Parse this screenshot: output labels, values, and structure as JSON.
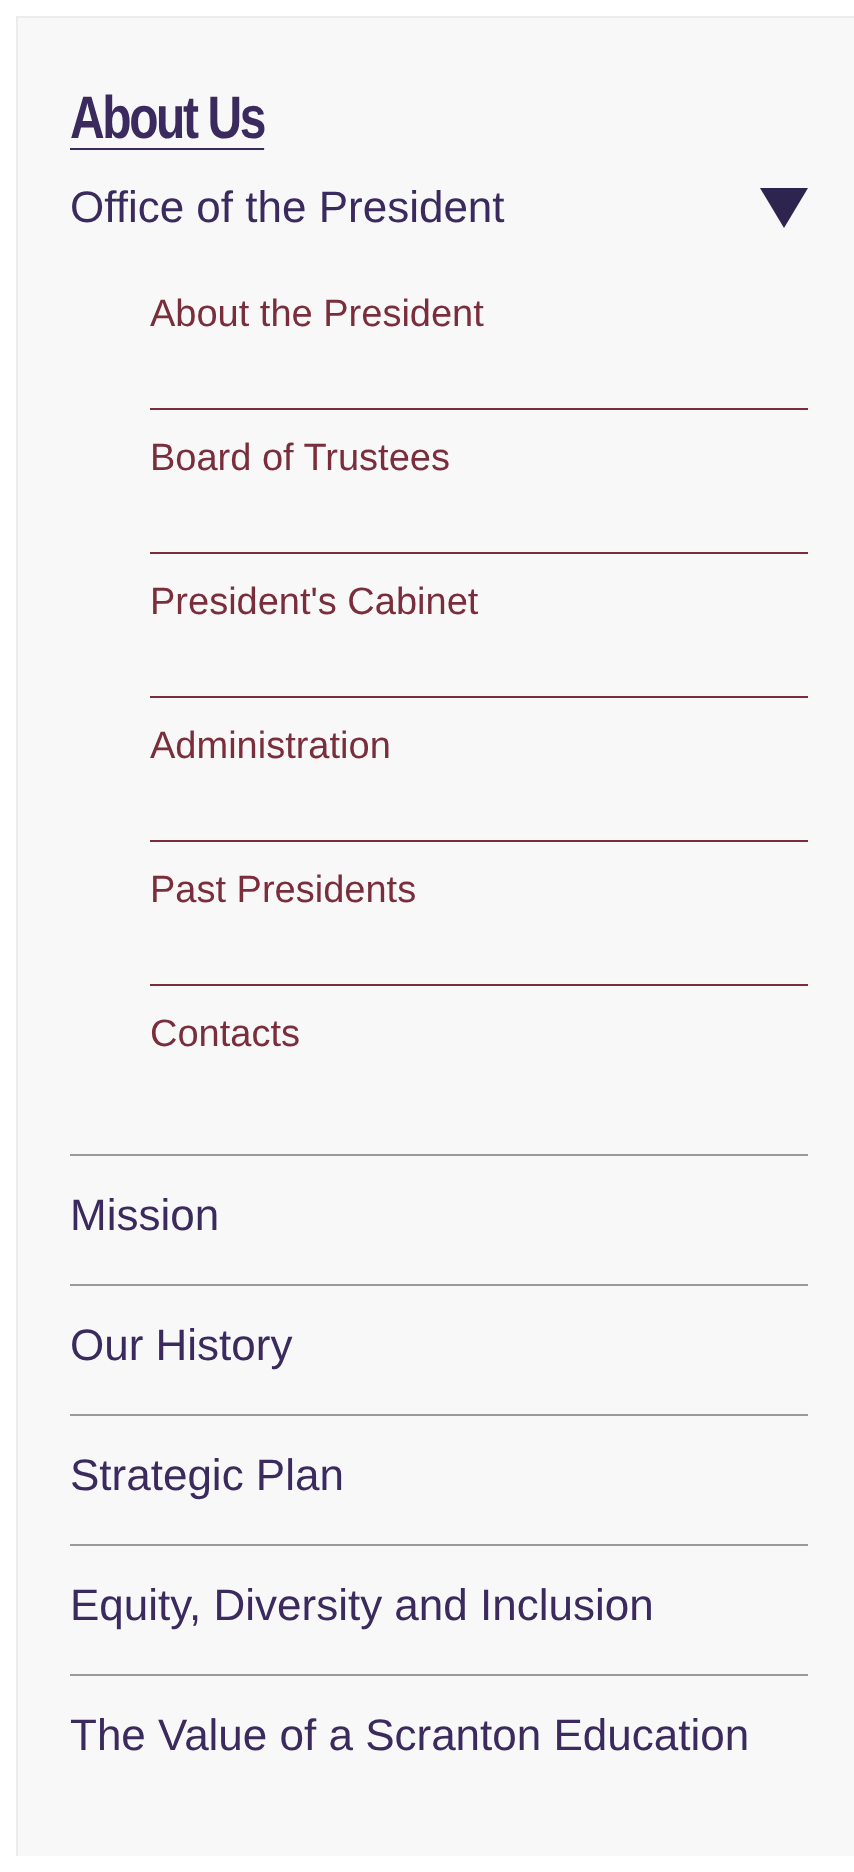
{
  "title": "About Us",
  "section": {
    "label": "Office of the President",
    "expanded": true,
    "children": [
      {
        "label": "About the President"
      },
      {
        "label": "Board of Trustees"
      },
      {
        "label": "President's Cabinet"
      },
      {
        "label": "Administration"
      },
      {
        "label": "Past Presidents"
      },
      {
        "label": "Contacts"
      }
    ]
  },
  "items": [
    {
      "label": "Mission"
    },
    {
      "label": "Our History"
    },
    {
      "label": "Strategic Plan"
    },
    {
      "label": "Equity, Diversity and Inclusion"
    },
    {
      "label": "The Value of a Scranton Education"
    }
  ]
}
